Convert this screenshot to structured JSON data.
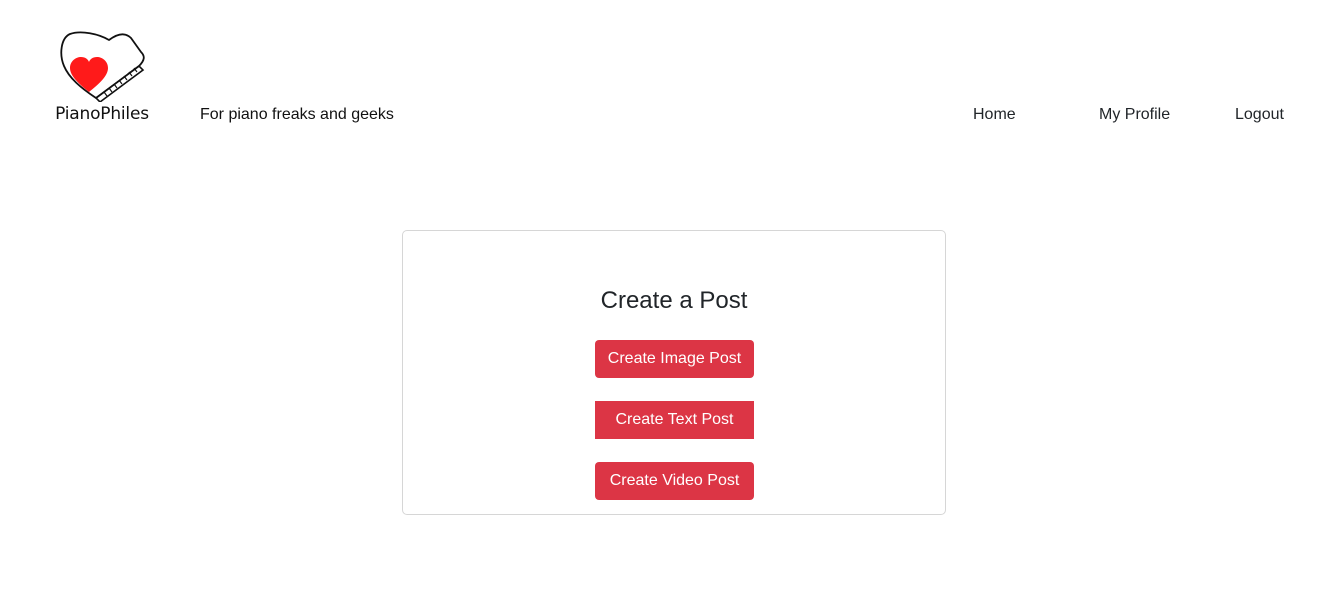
{
  "header": {
    "brand_name": "PianoPhiles",
    "logo_icon": "piano-heart-icon",
    "tagline": "For piano freaks and geeks",
    "nav": {
      "home": "Home",
      "profile": "My Profile",
      "logout": "Logout"
    }
  },
  "main": {
    "card": {
      "title": "Create a Post",
      "buttons": {
        "image": "Create Image Post",
        "text": "Create Text Post",
        "video": "Create Video Post"
      }
    }
  },
  "colors": {
    "accent": "#dc3545",
    "heart": "#ff1a1a",
    "text": "#212529",
    "border": "#d6d6d6"
  }
}
